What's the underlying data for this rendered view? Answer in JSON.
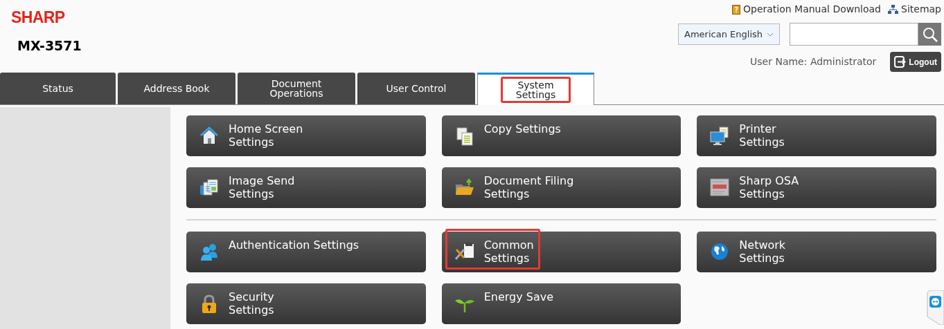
{
  "brand": {
    "logo": "SHARP",
    "model": "MX-3571"
  },
  "top_links": [
    {
      "label": "Operation Manual Download"
    },
    {
      "label": "Sitemap"
    }
  ],
  "language": {
    "value": "American English"
  },
  "user": {
    "label": "User Name: Administrator"
  },
  "logout": {
    "label": "Logout"
  },
  "tabs": [
    {
      "label": "Status",
      "selected": false,
      "highlighted": false
    },
    {
      "label": "Address Book",
      "selected": false,
      "highlighted": false
    },
    {
      "label": "Document\nOperations",
      "selected": false,
      "highlighted": false
    },
    {
      "label": "User Control",
      "selected": false,
      "highlighted": false
    },
    {
      "label": "System\nSettings",
      "selected": true,
      "highlighted": true
    }
  ],
  "settings_groups": [
    {
      "items": [
        {
          "label": "Home Screen\nSettings",
          "highlighted": false
        },
        {
          "label": "Copy Settings",
          "highlighted": false
        },
        {
          "label": "Printer\nSettings",
          "highlighted": false
        },
        {
          "label": "Image Send\nSettings",
          "highlighted": false
        },
        {
          "label": "Document Filing\nSettings",
          "highlighted": false
        },
        {
          "label": "Sharp OSA\nSettings",
          "highlighted": false
        }
      ]
    },
    {
      "items": [
        {
          "label": "Authentication Settings",
          "highlighted": false
        },
        {
          "label": "Common\nSettings",
          "highlighted": true
        },
        {
          "label": "Network\nSettings",
          "highlighted": false
        },
        {
          "label": "Security\nSettings",
          "highlighted": false
        },
        {
          "label": "Energy Save",
          "highlighted": false
        }
      ]
    }
  ]
}
